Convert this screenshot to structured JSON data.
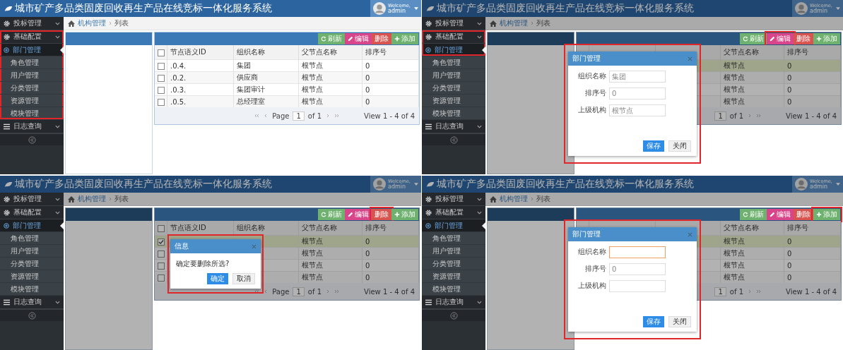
{
  "panels": [
    {
      "header": {
        "title": "城市矿产多品类固废回收再生产品在线竞标一体化服务系统",
        "welcome": "Welcome,",
        "user": "admin"
      },
      "sidebar": [
        {
          "label": "投标管理",
          "kind": "gear",
          "highlighted": false
        },
        {
          "label": "基础配置",
          "kind": "gear",
          "highlighted": true,
          "children": [
            {
              "label": "部门管理",
              "selected": true,
              "highlighted": true
            },
            {
              "label": "角色管理",
              "selected": false,
              "highlighted": true
            },
            {
              "label": "用户管理",
              "selected": false,
              "highlighted": true
            },
            {
              "label": "分类管理",
              "selected": false,
              "highlighted": true
            },
            {
              "label": "资源管理",
              "selected": false,
              "highlighted": true
            },
            {
              "label": "模块管理",
              "selected": false,
              "highlighted": true
            }
          ]
        },
        {
          "label": "日志查询",
          "kind": "list",
          "highlighted": false
        }
      ],
      "breadcrumb": [
        "机构管理",
        "列表"
      ],
      "toolbar": [
        {
          "label": "刷新",
          "kind": "refresh",
          "color": "#6fb26f",
          "highlighted": false
        },
        {
          "label": "编辑",
          "kind": "edit",
          "color": "#d9458a",
          "highlighted": false
        },
        {
          "label": "删除",
          "kind": "delete",
          "color": "#d9534f",
          "highlighted": false
        },
        {
          "label": "添加",
          "kind": "add",
          "color": "#6fb26f",
          "highlighted": false
        }
      ],
      "table": {
        "header_checked": false,
        "columns": [
          "节点语义ID",
          "组织名称",
          "父节点名称",
          "排序号"
        ],
        "rows": [
          {
            "checked": false,
            "selected": false,
            "cells": [
              ".0.4.",
              "集团",
              "根节点",
              "0"
            ]
          },
          {
            "checked": false,
            "selected": false,
            "cells": [
              ".0.2.",
              "供应商",
              "根节点",
              "0"
            ]
          },
          {
            "checked": false,
            "selected": false,
            "cells": [
              ".0.3.",
              "集团审计",
              "根节点",
              "0"
            ]
          },
          {
            "checked": false,
            "selected": false,
            "cells": [
              ".0.5.",
              "总经理室",
              "根节点",
              "0"
            ]
          }
        ]
      },
      "pager": {
        "back_arrows": true,
        "page_label": "Page",
        "page": "1",
        "of": "of 1",
        "view": "View 1 - 4 of 4"
      }
    },
    {
      "header": {
        "title": "城市矿产多品类固废回收再生产品在线竞标一体化服务系统",
        "welcome": "Welcome,",
        "user": "admin"
      },
      "sidebar": [
        {
          "label": "投标管理",
          "kind": "gear",
          "highlighted": false
        },
        {
          "label": "基础配置",
          "kind": "gear",
          "highlighted": true,
          "children": [
            {
              "label": "部门管理",
              "selected": true,
              "highlighted": true
            },
            {
              "label": "角色管理",
              "selected": false,
              "highlighted": false
            },
            {
              "label": "用户管理",
              "selected": false,
              "highlighted": false
            },
            {
              "label": "分类管理",
              "selected": false,
              "highlighted": false
            },
            {
              "label": "资源管理",
              "selected": false,
              "highlighted": false
            },
            {
              "label": "模块管理",
              "selected": false,
              "highlighted": false
            }
          ]
        },
        {
          "label": "日志查询",
          "kind": "list",
          "highlighted": false
        }
      ],
      "breadcrumb": [
        "机构管理",
        "列表"
      ],
      "toolbar": [
        {
          "label": "刷新",
          "kind": "refresh",
          "color": "#6fb26f",
          "highlighted": false
        },
        {
          "label": "编辑",
          "kind": "edit",
          "color": "#d9458a",
          "highlighted": true
        },
        {
          "label": "删除",
          "kind": "delete",
          "color": "#d9534f",
          "highlighted": false
        },
        {
          "label": "添加",
          "kind": "add",
          "color": "#6fb26f",
          "highlighted": false
        }
      ],
      "table": {
        "columns": [
          null,
          null,
          "父节点名称",
          "排序号"
        ],
        "rows": [
          {
            "selected": true,
            "cells": [
              null,
              null,
              "根节点",
              "0"
            ]
          },
          {
            "selected": false,
            "cells": [
              null,
              null,
              "根节点",
              "0"
            ]
          },
          {
            "selected": false,
            "cells": [
              null,
              null,
              "根节点",
              "0"
            ]
          },
          {
            "selected": false,
            "cells": [
              null,
              null,
              "根节点",
              "0"
            ]
          }
        ]
      },
      "pager": {
        "back_arrows": false,
        "page": "1",
        "of": "of 1",
        "view": "View 1 - 4 of 4"
      },
      "dialog": {
        "kind": "form",
        "highlighted": true,
        "title": "部门管理",
        "fields": [
          {
            "label": "组织名称",
            "value": "集团",
            "focused": false
          },
          {
            "label": "排序号",
            "value": "0",
            "focused": false
          },
          {
            "label": "上级机构",
            "value": "根节点",
            "focused": false
          }
        ],
        "buttons": [
          "保存",
          "关闭"
        ]
      }
    },
    {
      "header": {
        "title": "城市矿产多品类固废回收再生产品在线竞标一体化服务系统",
        "welcome": "Welcome,",
        "user": "admin"
      },
      "sidebar": [
        {
          "label": "投标管理",
          "kind": "gear",
          "highlighted": false
        },
        {
          "label": "基础配置",
          "kind": "gear",
          "highlighted": false,
          "children": [
            {
              "label": "部门管理",
              "selected": true,
              "highlighted": false
            },
            {
              "label": "角色管理",
              "selected": false,
              "highlighted": false
            },
            {
              "label": "用户管理",
              "selected": false,
              "highlighted": false
            },
            {
              "label": "分类管理",
              "selected": false,
              "highlighted": false
            },
            {
              "label": "资源管理",
              "selected": false,
              "highlighted": false
            },
            {
              "label": "模块管理",
              "selected": false,
              "highlighted": false
            }
          ]
        },
        {
          "label": "日志查询",
          "kind": "list",
          "highlighted": false
        }
      ],
      "breadcrumb": [
        "机构管理",
        "列表"
      ],
      "toolbar": [
        {
          "label": "刷新",
          "kind": "refresh",
          "color": "#6fb26f",
          "highlighted": false
        },
        {
          "label": "编辑",
          "kind": "edit",
          "color": "#d9458a",
          "highlighted": false
        },
        {
          "label": "删除",
          "kind": "delete",
          "color": "#d9534f",
          "highlighted": true
        },
        {
          "label": "添加",
          "kind": "add",
          "color": "#6fb26f",
          "highlighted": false
        }
      ],
      "table": {
        "header_checked": false,
        "columns": [
          "节点语义ID",
          "组织名称",
          "父节点名称",
          "排序号"
        ],
        "rows": [
          {
            "checked": true,
            "selected": true,
            "cells": [
              null,
              null,
              "根节点",
              "0"
            ]
          },
          {
            "checked": false,
            "selected": false,
            "cells": [
              null,
              null,
              "根节点",
              "0"
            ]
          },
          {
            "checked": false,
            "selected": false,
            "cells": [
              null,
              null,
              "根节点",
              "0"
            ]
          },
          {
            "checked": false,
            "selected": false,
            "cells": [
              null,
              null,
              "根节点",
              "0"
            ]
          }
        ]
      },
      "pager": {
        "back_arrows": true,
        "page_label": "Page",
        "page": "1",
        "of": "of 1",
        "view": "View 1 - 4 of 4"
      },
      "dialog": {
        "kind": "confirm",
        "highlighted": true,
        "title": "信息",
        "message": "确定要删除所选?",
        "buttons": [
          "确定",
          "取消"
        ]
      }
    },
    {
      "header": {
        "title": "城市矿产多品类固废回收再生产品在线竞标一体化服务系统",
        "welcome": "Welcome,",
        "user": "admin"
      },
      "sidebar": [
        {
          "label": "投标管理",
          "kind": "gear",
          "highlighted": false
        },
        {
          "label": "基础配置",
          "kind": "gear",
          "highlighted": false,
          "children": [
            {
              "label": "部门管理",
              "selected": true,
              "highlighted": false
            },
            {
              "label": "角色管理",
              "selected": false,
              "highlighted": false
            },
            {
              "label": "用户管理",
              "selected": false,
              "highlighted": false
            },
            {
              "label": "分类管理",
              "selected": false,
              "highlighted": false
            },
            {
              "label": "资源管理",
              "selected": false,
              "highlighted": false
            },
            {
              "label": "模块管理",
              "selected": false,
              "highlighted": false
            }
          ]
        },
        {
          "label": "日志查询",
          "kind": "list",
          "highlighted": false
        }
      ],
      "breadcrumb": [
        "机构管理",
        "列表"
      ],
      "toolbar": [
        {
          "label": "刷新",
          "kind": "refresh",
          "color": "#6fb26f",
          "highlighted": false
        },
        {
          "label": "编辑",
          "kind": "edit",
          "color": "#d9458a",
          "highlighted": false
        },
        {
          "label": "删除",
          "kind": "delete",
          "color": "#d9534f",
          "highlighted": false
        },
        {
          "label": "添加",
          "kind": "add",
          "color": "#6fb26f",
          "highlighted": true
        }
      ],
      "table": {
        "columns": [
          null,
          null,
          "父节点名称",
          "排序号"
        ],
        "rows": [
          {
            "selected": true,
            "cells": [
              null,
              null,
              "根节点",
              "0"
            ]
          },
          {
            "selected": false,
            "cells": [
              null,
              null,
              "根节点",
              "0"
            ]
          },
          {
            "selected": false,
            "cells": [
              null,
              null,
              "根节点",
              "0"
            ]
          },
          {
            "selected": false,
            "cells": [
              null,
              null,
              "根节点",
              "0"
            ]
          }
        ]
      },
      "pager": {
        "back_arrows": false,
        "page": "1",
        "of": "of 1",
        "view": "View 1 - 4 of 4"
      },
      "dialog": {
        "kind": "form",
        "highlighted": true,
        "title": "部门管理",
        "fields": [
          {
            "label": "组织名称",
            "focused": true
          },
          {
            "label": "排序号",
            "value": "0",
            "focused": false
          },
          {
            "label": "上级机构",
            "focused": false
          }
        ],
        "buttons": [
          "保存",
          "关闭"
        ]
      }
    }
  ]
}
